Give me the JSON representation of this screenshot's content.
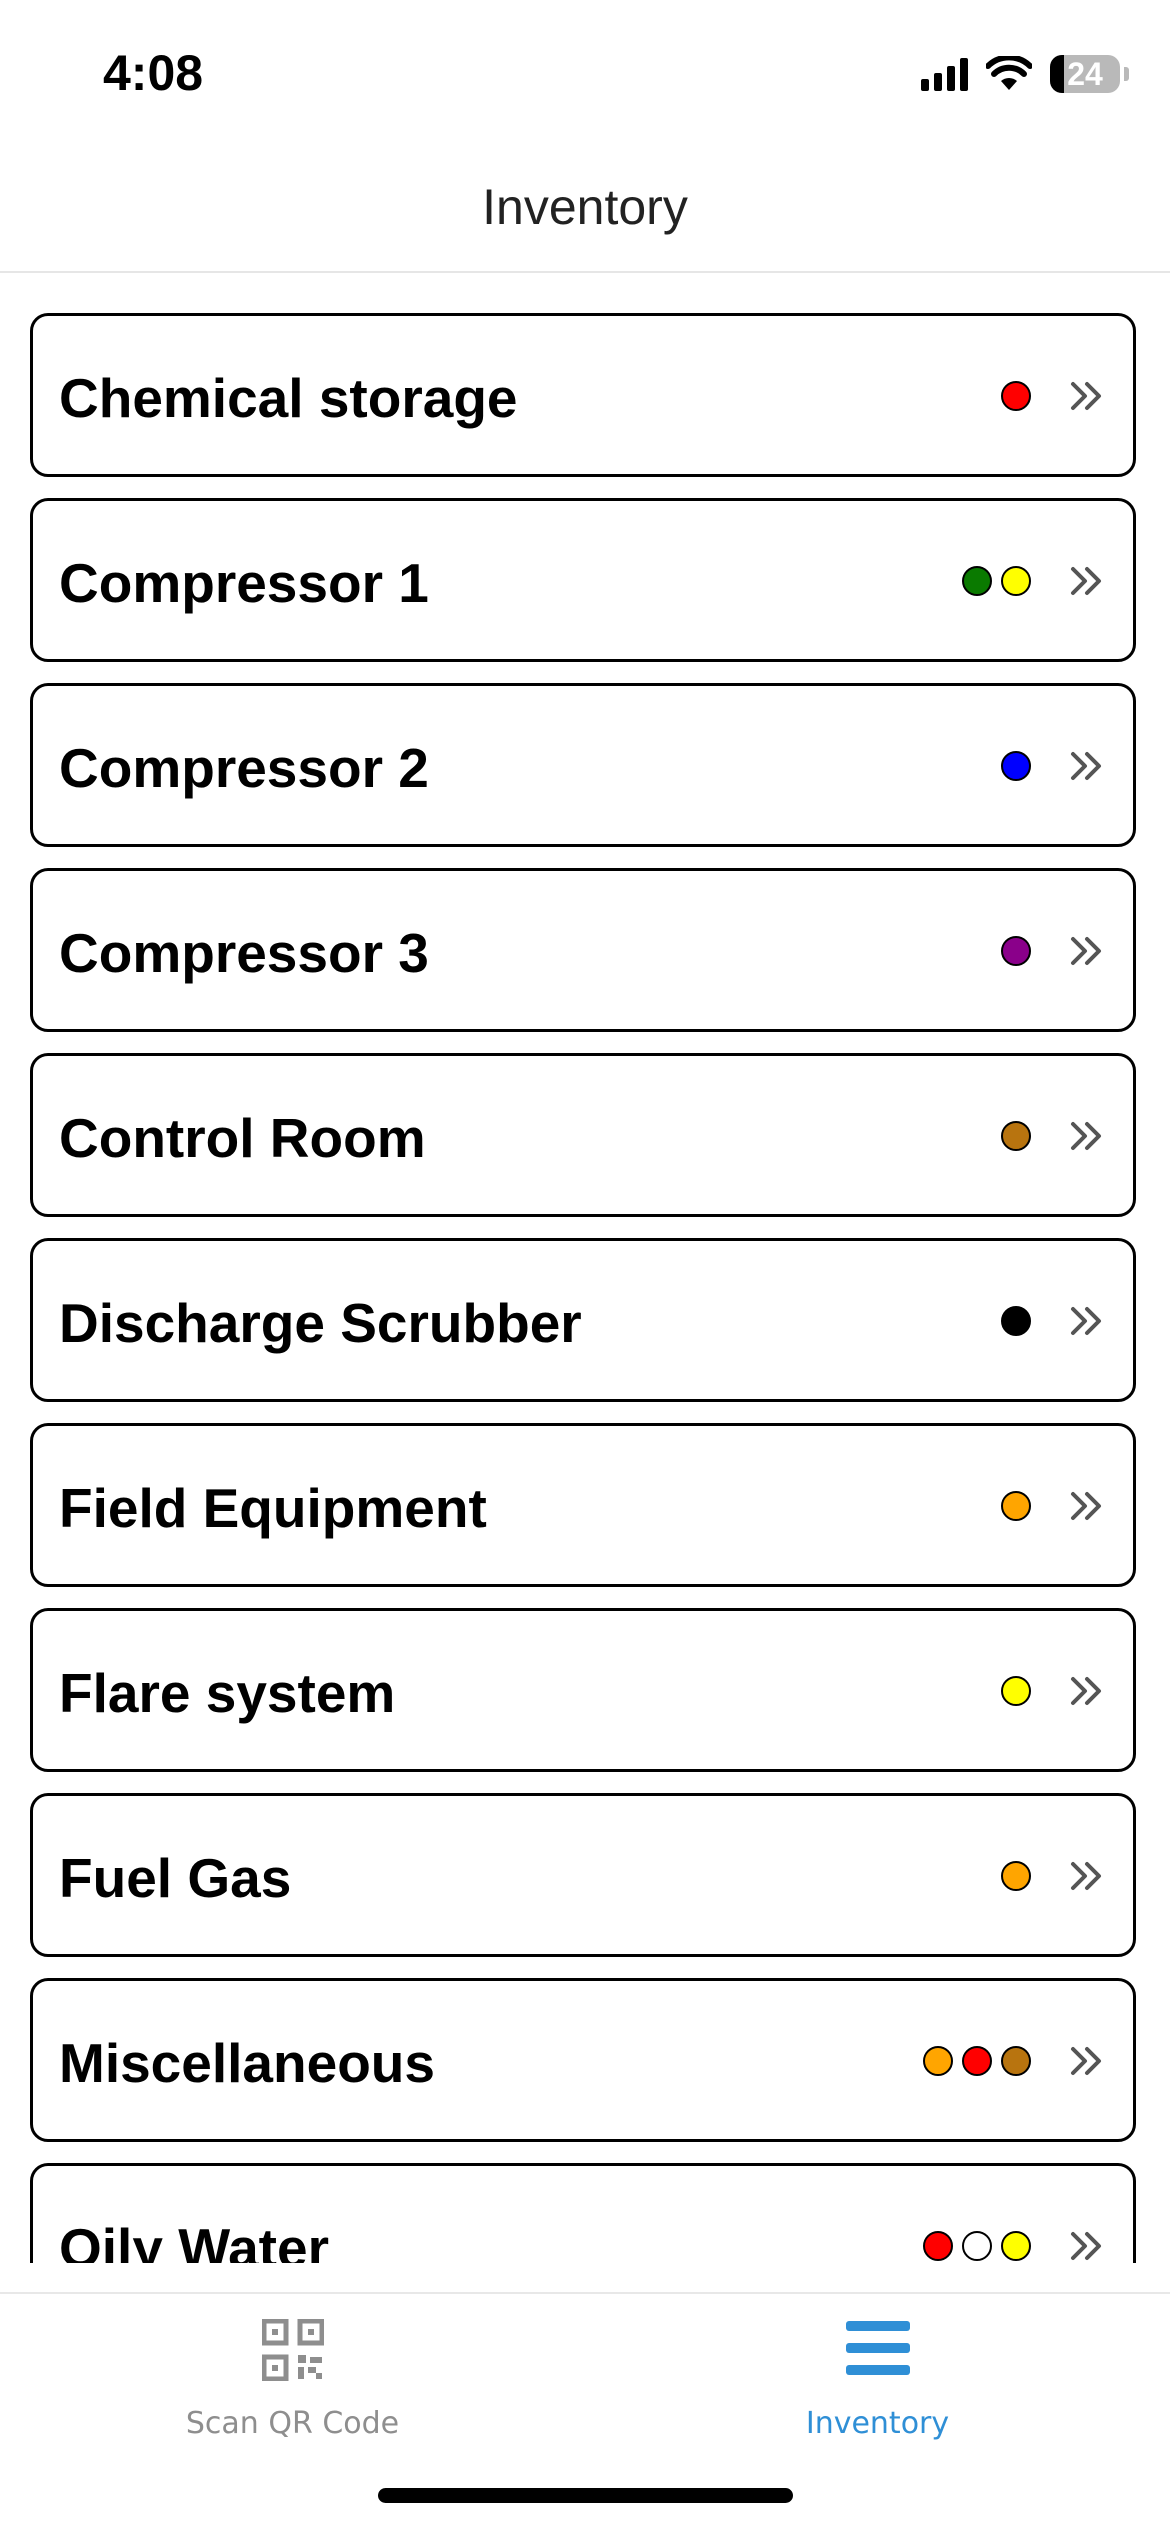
{
  "status": {
    "time": "4:08",
    "battery": "24"
  },
  "header": {
    "title": "Inventory"
  },
  "rows": [
    {
      "label": "Chemical storage",
      "dots": [
        "#ff0000"
      ]
    },
    {
      "label": "Compressor 1",
      "dots": [
        "#0a7a00",
        "#ffff00"
      ]
    },
    {
      "label": "Compressor 2",
      "dots": [
        "#0000ff"
      ]
    },
    {
      "label": "Compressor 3",
      "dots": [
        "#8a008a"
      ]
    },
    {
      "label": "Control Room",
      "dots": [
        "#b8740f"
      ]
    },
    {
      "label": "Discharge Scrubber",
      "dots": [
        "#000000"
      ]
    },
    {
      "label": "Field Equipment",
      "dots": [
        "#ffa500"
      ]
    },
    {
      "label": "Flare system",
      "dots": [
        "#ffff00"
      ]
    },
    {
      "label": "Fuel Gas",
      "dots": [
        "#ffa500"
      ]
    },
    {
      "label": "Miscellaneous",
      "dots": [
        "#ffa500",
        "#ff0000",
        "#b8740f"
      ]
    },
    {
      "label": "Oily Water",
      "dots": [
        "#ff0000",
        "#ffffff",
        "#ffff00"
      ]
    }
  ],
  "tabs": [
    {
      "label": "Scan QR Code",
      "icon": "qr-code-icon",
      "active": false,
      "color": "#8e8e8e"
    },
    {
      "label": "Inventory",
      "icon": "menu-icon",
      "active": true,
      "color": "#2f8fd6"
    }
  ]
}
